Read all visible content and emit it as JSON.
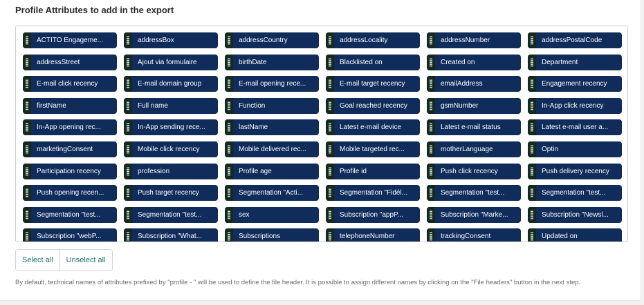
{
  "section": {
    "title": "Profile Attributes to add in the export"
  },
  "attributes": [
    "ACTITO Engageme...",
    "addressBox",
    "addressCountry",
    "addressLocality",
    "addressNumber",
    "addressPostalCode",
    "addressStreet",
    "Ajout via formulaire",
    "birthDate",
    "Blacklisted on",
    "Created on",
    "Department",
    "E-mail click recency",
    "E-mail domain group",
    "E-mail opening rece...",
    "E-mail target recency",
    "emailAddress",
    "Engagement recency",
    "firstName",
    "Full name",
    "Function",
    "Goal reached recency",
    "gsmNumber",
    "In-App click recency",
    "In-App opening rec...",
    "In-App sending rece...",
    "lastName",
    "Latest e-mail device",
    "Latest e-mail status",
    "Latest e-mail user a...",
    "marketingConsent",
    "Mobile click recency",
    "Mobile delivered rec...",
    "Mobile targeted rec...",
    "motherLanguage",
    "Optin",
    "Participation recency",
    "profession",
    "Profile age",
    "Profile id",
    "Push click recency",
    "Push delivery recency",
    "Push opening recen...",
    "Push target recency",
    "Segmentation \"Acti...",
    "Segmentation \"Fidél...",
    "Segmentation \"test...",
    "Segmentation \"test...",
    "Segmentation \"test...",
    "Segmentation \"test...",
    "sex",
    "Subscription \"appP...",
    "Subscription \"Marke...",
    "Subscription \"Newsl...",
    "Subscription \"webP...",
    "Subscription \"What...",
    "Subscriptions",
    "telephoneNumber",
    "trackingConsent",
    "Updated on"
  ],
  "actions": {
    "select_all": "Select all",
    "unselect_all": "Unselect all"
  },
  "footer_note": "By default, technical names of attributes prefixed by \"profile - \" will be used to define the file header. It is possible to assign different names by clicking on the \"File headers\" button in the next step.",
  "colors": {
    "chip_background": "#0f2c5b",
    "chip_handle": "#15291f",
    "button_text": "#1d6f72"
  },
  "icons": {
    "chip_handle": "drag-handle-icon"
  }
}
